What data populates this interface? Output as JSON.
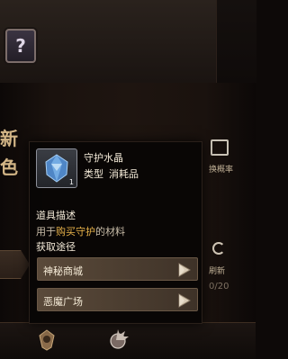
{
  "item": {
    "name": "守护水晶",
    "type_key": "类型",
    "type_value": "消耗品",
    "count": "1"
  },
  "description": {
    "title": "道具描述",
    "text_prefix": "用于",
    "text_highlight": "购买守护",
    "text_suffix": "的材料"
  },
  "sources": {
    "title": "获取途径",
    "items": [
      {
        "label": "神秘商城"
      },
      {
        "label": "恶魔广场"
      }
    ]
  },
  "background": {
    "left_text_1": "新",
    "left_text_2": "色",
    "right_label_1": "换概率",
    "right_label_2": "刷新",
    "right_counter": "0/20"
  },
  "colors": {
    "highlight": "#e8b24a",
    "crystal": "#6fa8dc"
  }
}
